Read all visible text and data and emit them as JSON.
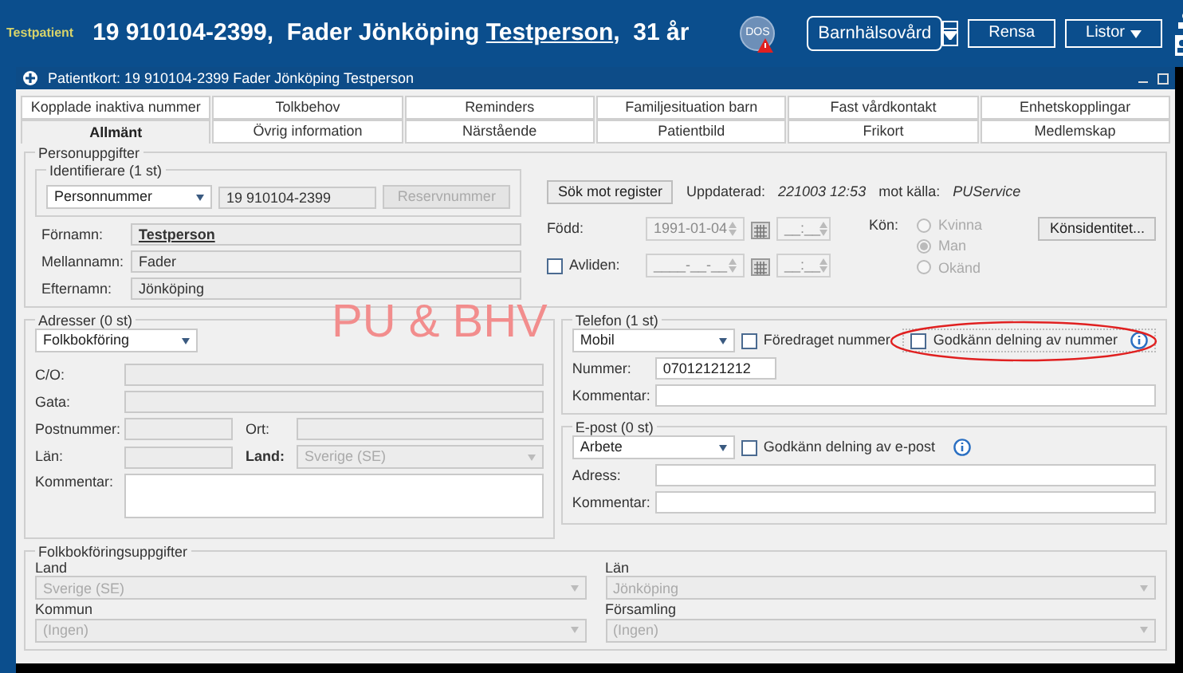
{
  "header": {
    "badge": "Testpatient",
    "title_before": "19 910104-2399,  Fader Jönköping ",
    "title_surname": "Testperson",
    "title_after": ",  31 år",
    "status_badge": "DOS",
    "unit_button": "Barnhälsovård",
    "buttons": [
      {
        "label": "Rensa",
        "kind": "plain"
      },
      {
        "label": "Listor",
        "kind": "menu"
      }
    ]
  },
  "window": {
    "title": "Patientkort: 19 910104-2399 Fader Jönköping Testperson"
  },
  "tab_rows": [
    [
      {
        "label": "Kopplade inaktiva nummer",
        "selected": false
      },
      {
        "label": "Tolkbehov",
        "selected": false
      },
      {
        "label": "Reminders",
        "selected": false
      },
      {
        "label": "Familjesituation barn",
        "selected": false
      },
      {
        "label": "Fast vårdkontakt",
        "selected": false
      },
      {
        "label": "Enhetskopplingar",
        "selected": false
      }
    ],
    [
      {
        "label": "Allmänt",
        "selected": true
      },
      {
        "label": "Övrig information",
        "selected": false
      },
      {
        "label": "Närstående",
        "selected": false
      },
      {
        "label": "Patientbild",
        "selected": false
      },
      {
        "label": "Frikort",
        "selected": false
      },
      {
        "label": "Medlemskap",
        "selected": false
      }
    ]
  ],
  "person": {
    "legend": "Personuppgifter",
    "identifier": {
      "legend": "Identifierare (1 st)",
      "type": "Personnummer",
      "value": "19 910104-2399",
      "reserve_button": {
        "label": "Reservnummer",
        "disabled": true
      }
    },
    "names": [
      {
        "label": "Förnamn:",
        "value": "Testperson",
        "preferred": true
      },
      {
        "label": "Mellannamn:",
        "value": "Fader",
        "preferred": false
      },
      {
        "label": "Efternamn:",
        "value": "Jönköping",
        "preferred": false
      }
    ],
    "search_button": "Sök mot register",
    "updated_label": "Uppdaterad:",
    "updated_value": "221003 12:53",
    "source_label": "mot källa:",
    "source_value": "PUService",
    "born": {
      "label": "Född:",
      "date": "1991-01-04",
      "time": "__:__"
    },
    "deceased": {
      "label": "Avliden:",
      "checked": false,
      "date": "____-__-__",
      "time": "__:__"
    },
    "sex": {
      "label": "Kön:",
      "options": [
        {
          "label": "Kvinna",
          "selected": false
        },
        {
          "label": "Man",
          "selected": true
        },
        {
          "label": "Okänd",
          "selected": false
        }
      ],
      "identity_button": "Könsidentitet..."
    }
  },
  "address": {
    "legend": "Adresser (0 st)",
    "type": "Folkbokföring",
    "co_label": "C/O:",
    "street_label": "Gata:",
    "zip_label": "Postnummer:",
    "city_label": "Ort:",
    "county_label": "Län:",
    "country_label": "Land:",
    "country_value": "Sverige (SE)",
    "comment_label": "Kommentar:"
  },
  "phone": {
    "legend": "Telefon (1 st)",
    "type": "Mobil",
    "preferred": {
      "label": "Föredraget nummer",
      "checked": false
    },
    "share": {
      "label": "Godkänn delning av nummer",
      "checked": false
    },
    "number_label": "Nummer:",
    "number_value": "07012121212",
    "comment_label": "Kommentar:"
  },
  "email": {
    "legend": "E-post (0 st)",
    "type": "Arbete",
    "share": {
      "label": "Godkänn delning av e-post",
      "checked": false
    },
    "address_label": "Adress:",
    "comment_label": "Kommentar:"
  },
  "registry": {
    "legend": "Folkbokföringsuppgifter",
    "fields": [
      {
        "label": "Land",
        "value": "Sverige (SE)"
      },
      {
        "label": "Län",
        "value": "Jönköping"
      },
      {
        "label": "Kommun",
        "value": "(Ingen)"
      },
      {
        "label": "Församling",
        "value": "(Ingen)"
      }
    ]
  },
  "annotation": {
    "text": "PU & BHV"
  }
}
